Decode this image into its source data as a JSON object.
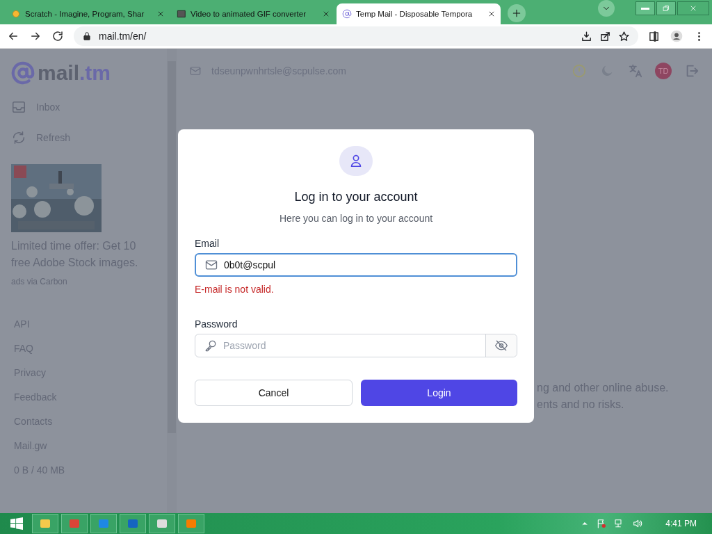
{
  "browser": {
    "tabs": [
      {
        "title": "Scratch - Imagine, Program, Shar",
        "selected": false
      },
      {
        "title": "Video to animated GIF converter",
        "selected": false
      },
      {
        "title": "Temp Mail - Disposable Tempora",
        "selected": true
      }
    ],
    "address": "mail.tm/en/"
  },
  "sidebar": {
    "logo": {
      "name": "mail",
      "suffix": ".tm"
    },
    "nav": [
      {
        "label": "Inbox",
        "kind": "inbox"
      },
      {
        "label": "Refresh",
        "kind": "refresh"
      }
    ],
    "ad": {
      "kind": "picture",
      "text": "Limited time offer: Get 10 free Adobe Stock images.",
      "via": "ads via Carbon"
    },
    "links": [
      "API",
      "FAQ",
      "Privacy",
      "Feedback",
      "Contacts",
      "Mail.gw"
    ],
    "storage": "0 B / 40 MB"
  },
  "header": {
    "email": "tdseunpwnhrtsle@scpulse.com",
    "avatar": "TD"
  },
  "body_text": [
    "ng and other online abuse.",
    "ents and no risks."
  ],
  "modal": {
    "title": "Log in to your account",
    "subtitle": "Here you can log in to your account",
    "email": {
      "label": "Email",
      "value": "0b0t@scpul",
      "focused": true,
      "error": "E-mail is not valid."
    },
    "password": {
      "label": "Password",
      "placeholder": "Password"
    },
    "buttons": [
      {
        "label": "Cancel",
        "kind": "secondary"
      },
      {
        "label": "Login",
        "kind": "primary"
      }
    ]
  },
  "taskbar": {
    "time": "4:41 PM"
  }
}
